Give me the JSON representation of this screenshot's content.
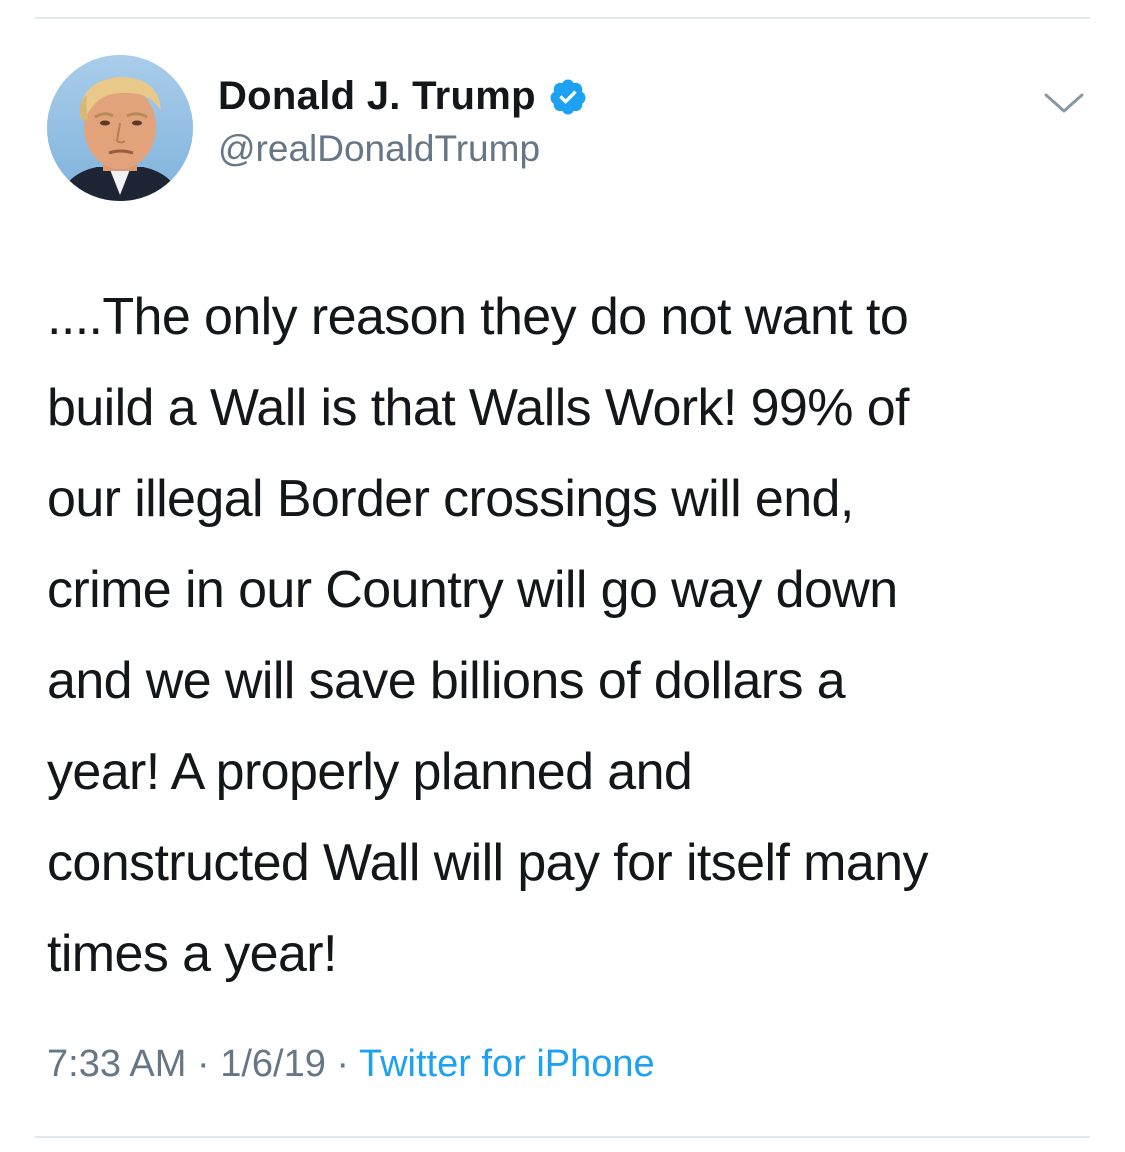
{
  "tweet": {
    "author": {
      "display_name": "Donald J. Trump",
      "handle": "@realDonaldTrump",
      "verified": true,
      "avatar_icon": "profile-photo"
    },
    "text": "....The only reason they do not want to\nbuild a Wall is that Walls Work! 99% of\nour illegal Border crossings will end,\ncrime in our Country will go way down\nand we will save billions of dollars a\nyear! A properly planned and\nconstructed Wall will pay for itself many\ntimes a year!",
    "meta": {
      "time": "7:33 AM",
      "separator": " · ",
      "date": "1/6/19",
      "source": "Twitter for iPhone"
    }
  },
  "colors": {
    "text": "#14171a",
    "secondary": "#657786",
    "link": "#1da1f2",
    "verified_badge": "#1da1f2",
    "divider": "#e1e8ed"
  },
  "icons": {
    "verified": "verified-badge-icon",
    "menu": "chevron-down-icon"
  }
}
